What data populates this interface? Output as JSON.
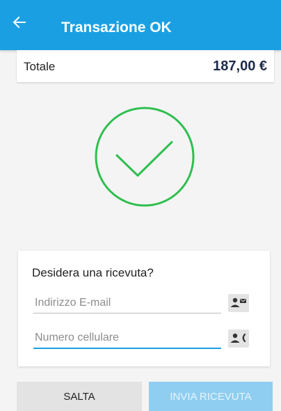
{
  "header": {
    "title": "Transazione OK",
    "back_icon": "arrow-left-icon",
    "background_color": "#1aa0e2"
  },
  "total": {
    "label": "Totale",
    "amount": "187,00 €"
  },
  "status": {
    "icon": "checkmark-circle-icon",
    "color": "#2fbf4f"
  },
  "receipt": {
    "question": "Desidera una ricevuta?",
    "email_placeholder": "Indirizzo E-mail",
    "email_value": "",
    "email_contact_icon": "contact-email-icon",
    "phone_placeholder": "Numero cellulare",
    "phone_value": "",
    "phone_contact_icon": "contact-phone-icon"
  },
  "actions": {
    "skip_label": "SALTA",
    "send_label": "INVIA RICEVUTA",
    "send_enabled": false
  }
}
